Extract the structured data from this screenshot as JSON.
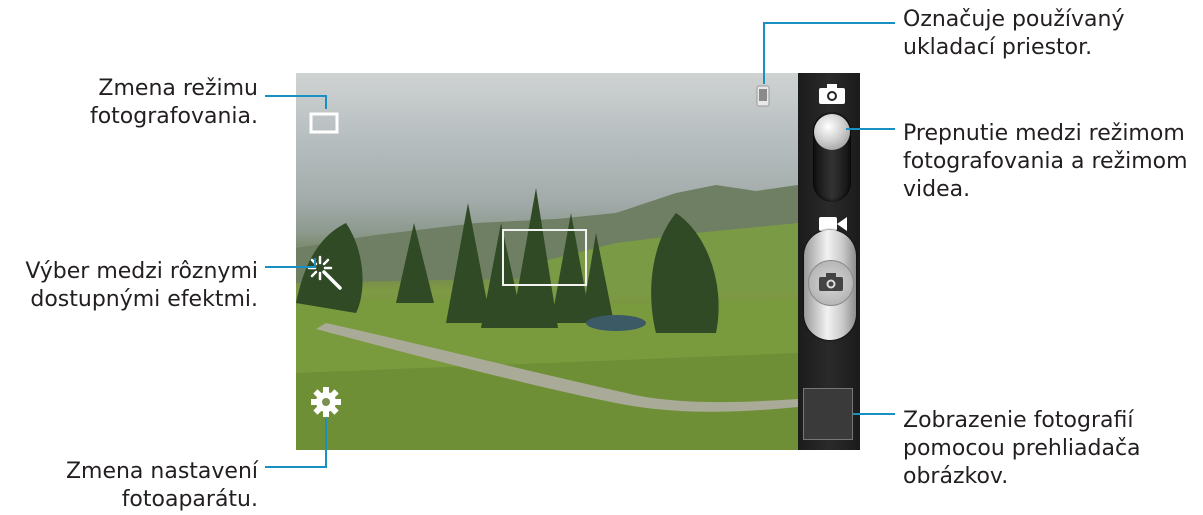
{
  "callouts": {
    "shooting_mode": "Zmena režimu\nfotografovania.",
    "effects": "Výber medzi rôznymi\ndostupnými efektmi.",
    "settings": "Zmena nastavení\nfotoaparátu.",
    "storage": "Označuje používaný\nukladací priestor.",
    "mode_switch": "Prepnutie medzi režimom\nfotografovania a režimom\nvidea.",
    "image_viewer": "Zobrazenie fotografií\npomocou prehliadača\nobrázkov."
  },
  "colors": {
    "callout_line": "#1a8fc1",
    "sidebar": "#222222",
    "text": "#231f20"
  },
  "icons": {
    "shooting_mode": "square-frame-icon",
    "effects": "magic-wand-icon",
    "settings": "gear-icon",
    "storage": "phone-storage-icon",
    "camera_mode": "camera-icon",
    "video_mode": "video-camera-icon",
    "shutter": "camera-icon",
    "thumbnail": "image-thumbnail"
  }
}
